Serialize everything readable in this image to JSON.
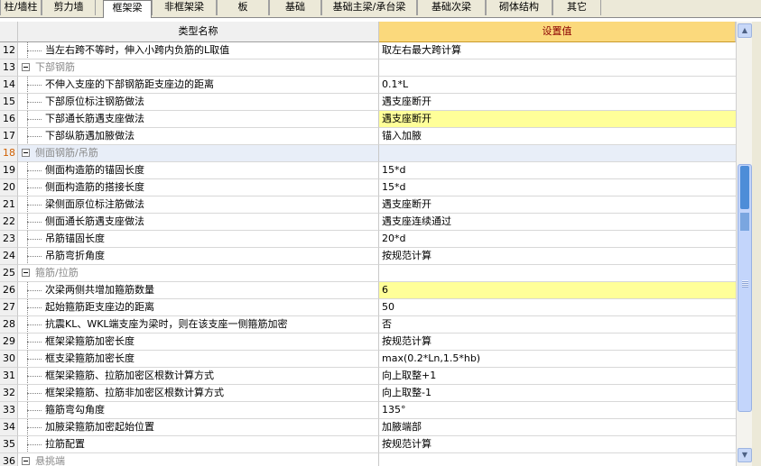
{
  "tabs": [
    {
      "label": "柱/墙柱",
      "active": false
    },
    {
      "label": "剪力墙",
      "active": false
    },
    {
      "label": "框架梁",
      "active": true
    },
    {
      "label": "非框架梁",
      "active": false
    },
    {
      "label": "板",
      "active": false
    },
    {
      "label": "基础",
      "active": false
    },
    {
      "label": "基础主梁/承台梁",
      "active": false
    },
    {
      "label": "基础次梁",
      "active": false
    },
    {
      "label": "砌体结构",
      "active": false
    },
    {
      "label": "其它",
      "active": false
    }
  ],
  "grid": {
    "col_name": "类型名称",
    "col_value": "设置值",
    "rows": [
      {
        "num": "12",
        "name": "当左右跨不等时，伸入小跨内负筋的L取值",
        "value": "取左右最大跨计算",
        "type": "item",
        "highlight": false,
        "selected": false
      },
      {
        "num": "13",
        "name": "下部钢筋",
        "value": "",
        "type": "group",
        "highlight": false,
        "selected": false
      },
      {
        "num": "14",
        "name": "不伸入支座的下部钢筋距支座边的距离",
        "value": "0.1*L",
        "type": "item",
        "highlight": false,
        "selected": false
      },
      {
        "num": "15",
        "name": "下部原位标注钢筋做法",
        "value": "遇支座断开",
        "type": "item",
        "highlight": false,
        "selected": false
      },
      {
        "num": "16",
        "name": "下部通长筋遇支座做法",
        "value": "遇支座断开",
        "type": "item",
        "highlight": true,
        "selected": false
      },
      {
        "num": "17",
        "name": "下部纵筋遇加腋做法",
        "value": "锚入加腋",
        "type": "item",
        "highlight": false,
        "selected": false
      },
      {
        "num": "18",
        "name": "侧面钢筋/吊筋",
        "value": "",
        "type": "group",
        "highlight": false,
        "selected": true
      },
      {
        "num": "19",
        "name": "侧面构造筋的锚固长度",
        "value": "15*d",
        "type": "item",
        "highlight": false,
        "selected": false
      },
      {
        "num": "20",
        "name": "侧面构造筋的搭接长度",
        "value": "15*d",
        "type": "item",
        "highlight": false,
        "selected": false
      },
      {
        "num": "21",
        "name": "梁侧面原位标注筋做法",
        "value": "遇支座断开",
        "type": "item",
        "highlight": false,
        "selected": false
      },
      {
        "num": "22",
        "name": "侧面通长筋遇支座做法",
        "value": "遇支座连续通过",
        "type": "item",
        "highlight": false,
        "selected": false
      },
      {
        "num": "23",
        "name": "吊筋锚固长度",
        "value": "20*d",
        "type": "item",
        "highlight": false,
        "selected": false
      },
      {
        "num": "24",
        "name": "吊筋弯折角度",
        "value": "按规范计算",
        "type": "item",
        "highlight": false,
        "selected": false
      },
      {
        "num": "25",
        "name": "箍筋/拉筋",
        "value": "",
        "type": "group",
        "highlight": false,
        "selected": false
      },
      {
        "num": "26",
        "name": "次梁两侧共增加箍筋数量",
        "value": "6",
        "type": "item",
        "highlight": true,
        "selected": false
      },
      {
        "num": "27",
        "name": "起始箍筋距支座边的距离",
        "value": "50",
        "type": "item",
        "highlight": false,
        "selected": false
      },
      {
        "num": "28",
        "name": "抗震KL、WKL端支座为梁时，则在该支座一侧箍筋加密",
        "value": "否",
        "type": "item",
        "highlight": false,
        "selected": false
      },
      {
        "num": "29",
        "name": "框架梁箍筋加密长度",
        "value": "按规范计算",
        "type": "item",
        "highlight": false,
        "selected": false
      },
      {
        "num": "30",
        "name": "框支梁箍筋加密长度",
        "value": "max(0.2*Ln,1.5*hb)",
        "type": "item",
        "highlight": false,
        "selected": false
      },
      {
        "num": "31",
        "name": "框架梁箍筋、拉筋加密区根数计算方式",
        "value": "向上取整+1",
        "type": "item",
        "highlight": false,
        "selected": false
      },
      {
        "num": "32",
        "name": "框架梁箍筋、拉筋非加密区根数计算方式",
        "value": "向上取整-1",
        "type": "item",
        "highlight": false,
        "selected": false
      },
      {
        "num": "33",
        "name": "箍筋弯勾角度",
        "value": "135°",
        "type": "item",
        "highlight": false,
        "selected": false
      },
      {
        "num": "34",
        "name": "加腋梁箍筋加密起始位置",
        "value": "加腋端部",
        "type": "item",
        "highlight": false,
        "selected": false
      },
      {
        "num": "35",
        "name": "拉筋配置",
        "value": "按规范计算",
        "type": "item",
        "highlight": false,
        "selected": false
      },
      {
        "num": "36",
        "name": "悬挑端",
        "value": "",
        "type": "group",
        "highlight": false,
        "selected": false
      }
    ]
  },
  "icons": {
    "scroll_up": "chevron-up-icon",
    "scroll_down": "chevron-down-icon",
    "collapse": "minus-box-icon"
  }
}
